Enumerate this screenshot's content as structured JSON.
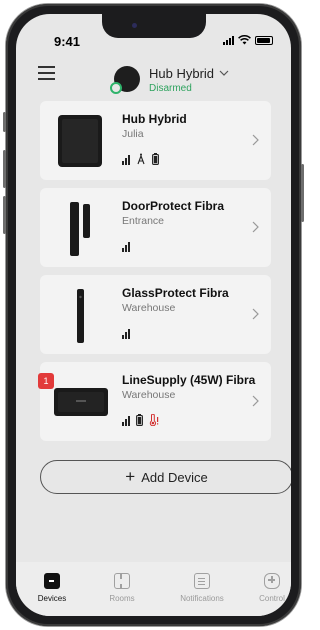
{
  "status_bar": {
    "time": "9:41"
  },
  "header": {
    "hub_name": "Hub Hybrid",
    "hub_status": "Disarmed"
  },
  "colors": {
    "armed_state_green": "#2fa35f",
    "alert_red": "#e23a3a"
  },
  "devices": [
    {
      "name": "Hub Hybrid",
      "location": "Julia",
      "status_icons": [
        "signal-icon",
        "antenna-icon",
        "battery-icon"
      ]
    },
    {
      "name": "DoorProtect Fibra",
      "location": "Entrance",
      "status_icons": [
        "signal-icon"
      ]
    },
    {
      "name": "GlassProtect Fibra",
      "location": "Warehouse",
      "status_icons": [
        "signal-icon"
      ]
    },
    {
      "name": "LineSupply (45W) Fibra",
      "location": "Warehouse",
      "status_icons": [
        "signal-icon",
        "battery-icon",
        "temperature-alert-icon"
      ],
      "alert_count": "1"
    }
  ],
  "add_device": {
    "label": "Add Device"
  },
  "tabs": [
    {
      "label": "Devices",
      "active": true
    },
    {
      "label": "Rooms"
    },
    {
      "label": "Notifications"
    },
    {
      "label": "Control"
    }
  ]
}
